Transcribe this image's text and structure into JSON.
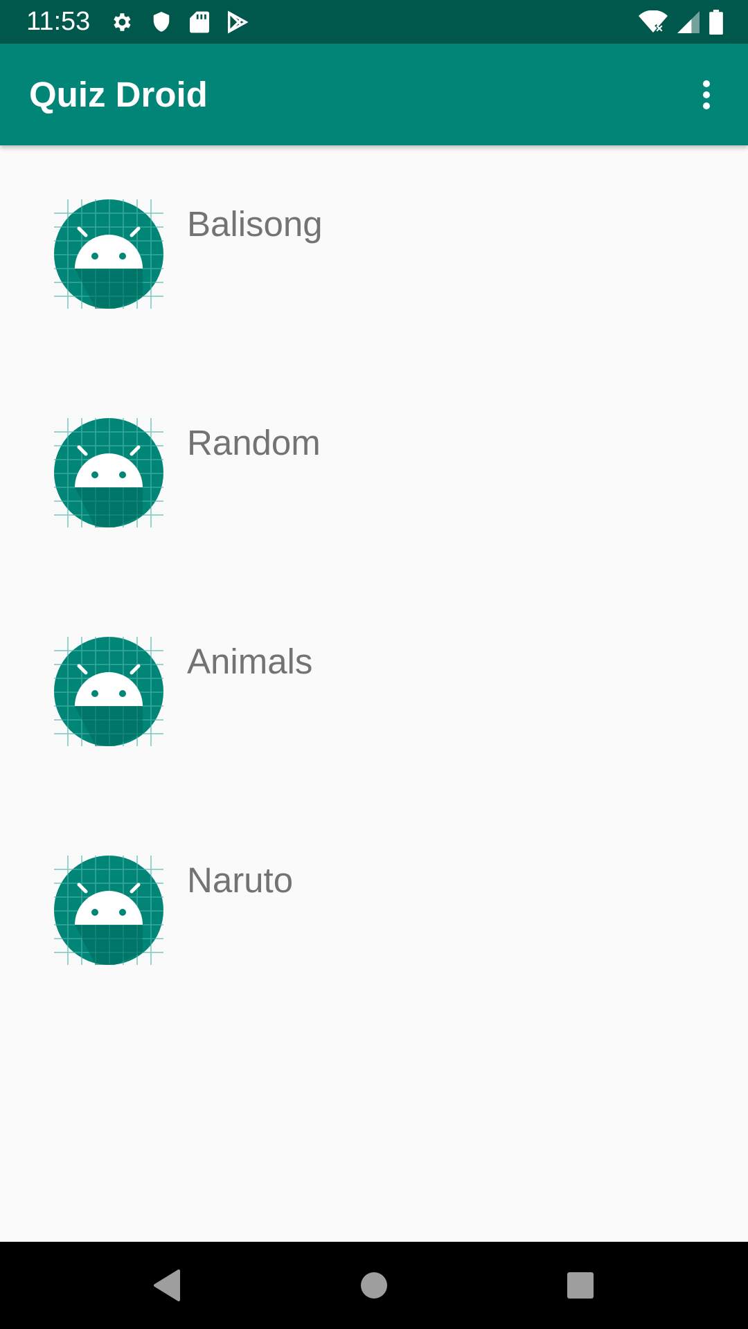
{
  "status_bar": {
    "time": "11:53",
    "left_icons": [
      "settings-icon",
      "shield-icon",
      "sd-card-icon",
      "play-store-icon"
    ],
    "right_icons": [
      "wifi-icon",
      "signal-icon",
      "battery-icon"
    ]
  },
  "app_bar": {
    "title": "Quiz Droid",
    "menu_icon": "more-vert-icon"
  },
  "list": {
    "items": [
      {
        "label": "Balisong",
        "icon": "android-app-icon"
      },
      {
        "label": "Random",
        "icon": "android-app-icon"
      },
      {
        "label": "Animals",
        "icon": "android-app-icon"
      },
      {
        "label": "Naruto",
        "icon": "android-app-icon"
      }
    ]
  },
  "nav_bar": {
    "buttons": [
      "back-icon",
      "home-icon",
      "recents-icon"
    ]
  },
  "colors": {
    "status_bar": "#00574b",
    "app_bar": "#008577",
    "background": "#fafafa",
    "item_text": "#737373",
    "nav_bar": "#000000"
  }
}
